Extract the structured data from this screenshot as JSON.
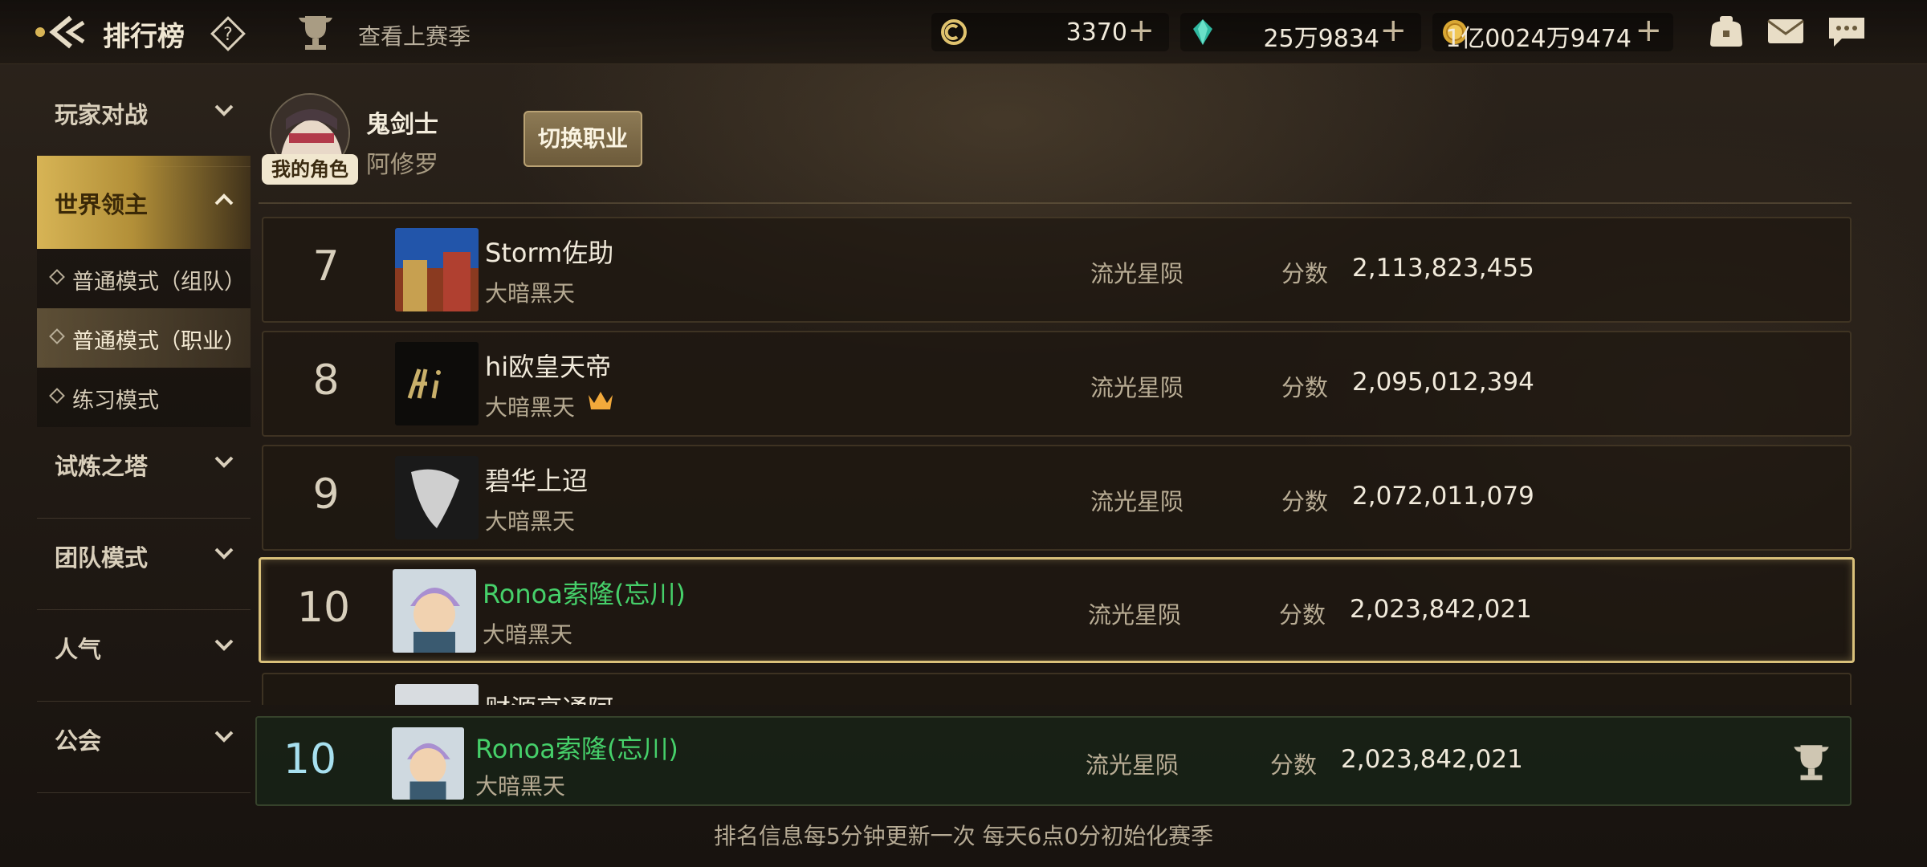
{
  "header": {
    "title": "排行榜",
    "last_season": "查看上赛季",
    "currencies": [
      {
        "icon": "coupon-icon",
        "value": "3370"
      },
      {
        "icon": "crystal-icon",
        "value": "25万9834"
      },
      {
        "icon": "gold-coin-icon",
        "value": "1亿0024万9474"
      }
    ],
    "plus": "+"
  },
  "sidebar": {
    "items": [
      {
        "label": "玩家对战"
      },
      {
        "label": "世界领主"
      },
      {
        "label": "试炼之塔"
      },
      {
        "label": "团队模式"
      },
      {
        "label": "人气"
      },
      {
        "label": "公会"
      }
    ],
    "subitems": [
      {
        "label": "普通模式（组队）"
      },
      {
        "label": "普通模式（职业）"
      },
      {
        "label": "练习模式"
      }
    ]
  },
  "my_role": {
    "badge": "我的角色",
    "class_name": "鬼剑士",
    "sub_class": "阿修罗",
    "switch_label": "切换职业"
  },
  "rows": [
    {
      "rank": "7",
      "name": "Storm佐助",
      "guild": "大暗黑天",
      "server": "流光星陨",
      "score_label": "分数",
      "score": "2,113,823,455"
    },
    {
      "rank": "8",
      "name": "hi欧皇天帝",
      "guild": "大暗黑天",
      "server": "流光星陨",
      "score_label": "分数",
      "score": "2,095,012,394"
    },
    {
      "rank": "9",
      "name": "碧华上迢",
      "guild": "大暗黑天",
      "server": "流光星陨",
      "score_label": "分数",
      "score": "2,072,011,079"
    },
    {
      "rank": "10",
      "name": "Ronoa索隆(忘川)",
      "guild": "大暗黑天",
      "server": "流光星陨",
      "score_label": "分数",
      "score": "2,023,842,021"
    },
    {
      "rank": "",
      "name": "财源亨通阿",
      "guild": "",
      "server": "",
      "score_label": "",
      "score": ""
    }
  ],
  "my_rank": {
    "rank": "10",
    "name": "Ronoa索隆(忘川)",
    "guild": "大暗黑天",
    "server": "流光星陨",
    "score_label": "分数",
    "score": "2,023,842,021"
  },
  "footer": "排名信息每5分钟更新一次 每天6点0分初始化赛季",
  "colors": {
    "accent_gold": "#d9c07a",
    "self_name_green": "#46d06a",
    "my_rank_cyan": "#a7e0ef"
  }
}
